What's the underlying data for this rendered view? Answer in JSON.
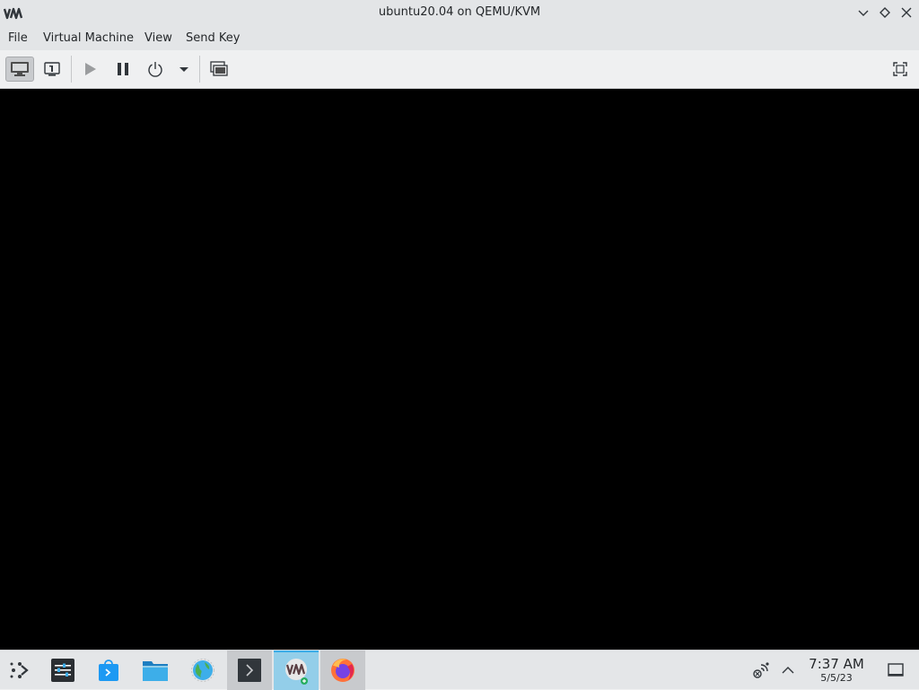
{
  "window": {
    "title": "ubuntu20.04 on QEMU/KVM",
    "app_icon": "virt-manager-icon"
  },
  "menubar": {
    "items": [
      "File",
      "Virtual Machine",
      "View",
      "Send Key"
    ]
  },
  "toolbar": {
    "buttons": [
      {
        "name": "show-console-button",
        "icon": "monitor-icon",
        "active": true
      },
      {
        "name": "show-details-button",
        "icon": "info-icon"
      },
      {
        "name": "run-button",
        "icon": "play-icon"
      },
      {
        "name": "pause-button",
        "icon": "pause-icon"
      },
      {
        "name": "shutdown-button",
        "icon": "power-icon"
      },
      {
        "name": "shutdown-menu-button",
        "icon": "chevron-down-icon"
      },
      {
        "name": "snapshots-button",
        "icon": "snapshots-icon"
      },
      {
        "name": "fullscreen-button",
        "icon": "fullscreen-icon"
      }
    ]
  },
  "colors": {
    "console_bg": "#000000",
    "active_task": "#93cee9",
    "accent": "#3daee9"
  },
  "taskbar": {
    "launcher_icon": "app-launcher-icon",
    "apps": [
      {
        "name": "system-settings",
        "icon": "settings-icon"
      },
      {
        "name": "discover",
        "icon": "store-icon"
      },
      {
        "name": "dolphin",
        "icon": "folder-icon"
      },
      {
        "name": "browser",
        "icon": "globe-icon"
      },
      {
        "name": "konsole",
        "icon": "terminal-icon"
      },
      {
        "name": "virt-manager",
        "icon": "virt-manager-icon",
        "active": true
      },
      {
        "name": "firefox",
        "icon": "firefox-icon"
      }
    ],
    "tray": {
      "network_icon": "network-icon",
      "expand_icon": "chevron-up-icon"
    },
    "clock": {
      "time": "7:37 AM",
      "date": "5/5/23"
    },
    "show_desktop_icon": "show-desktop-icon"
  }
}
